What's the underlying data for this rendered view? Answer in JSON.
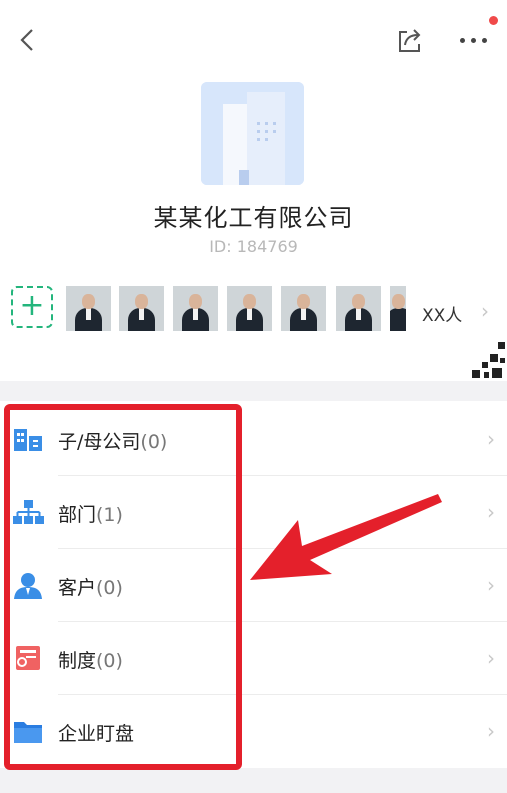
{
  "header": {
    "back_icon": "chevron-left-icon",
    "share_icon": "share-icon",
    "more_icon": "more-horizontal-icon",
    "notification_color": "#f04a4a"
  },
  "company": {
    "name": "某某化工有限公司",
    "id_text": "ID: 184769",
    "logo_icon": "building-icon"
  },
  "members": {
    "add_symbol": "+",
    "count_label": "XX人",
    "avatars": 7
  },
  "menu": [
    {
      "label": "子/母公司",
      "count": "(0)",
      "icon": "building-icon",
      "color": "#3a8ee6"
    },
    {
      "label": "部门",
      "count": "(1)",
      "icon": "org-chart-icon",
      "color": "#3a8ee6"
    },
    {
      "label": "客户",
      "count": "(0)",
      "icon": "user-icon",
      "color": "#3a8ee6"
    },
    {
      "label": "制度",
      "count": "(0)",
      "icon": "document-icon",
      "color": "#f06262"
    },
    {
      "label": "企业盯盘",
      "count": "",
      "icon": "folder-icon",
      "color": "#2a7de1"
    }
  ],
  "annotation": {
    "highlight_color": "#e4202b"
  }
}
